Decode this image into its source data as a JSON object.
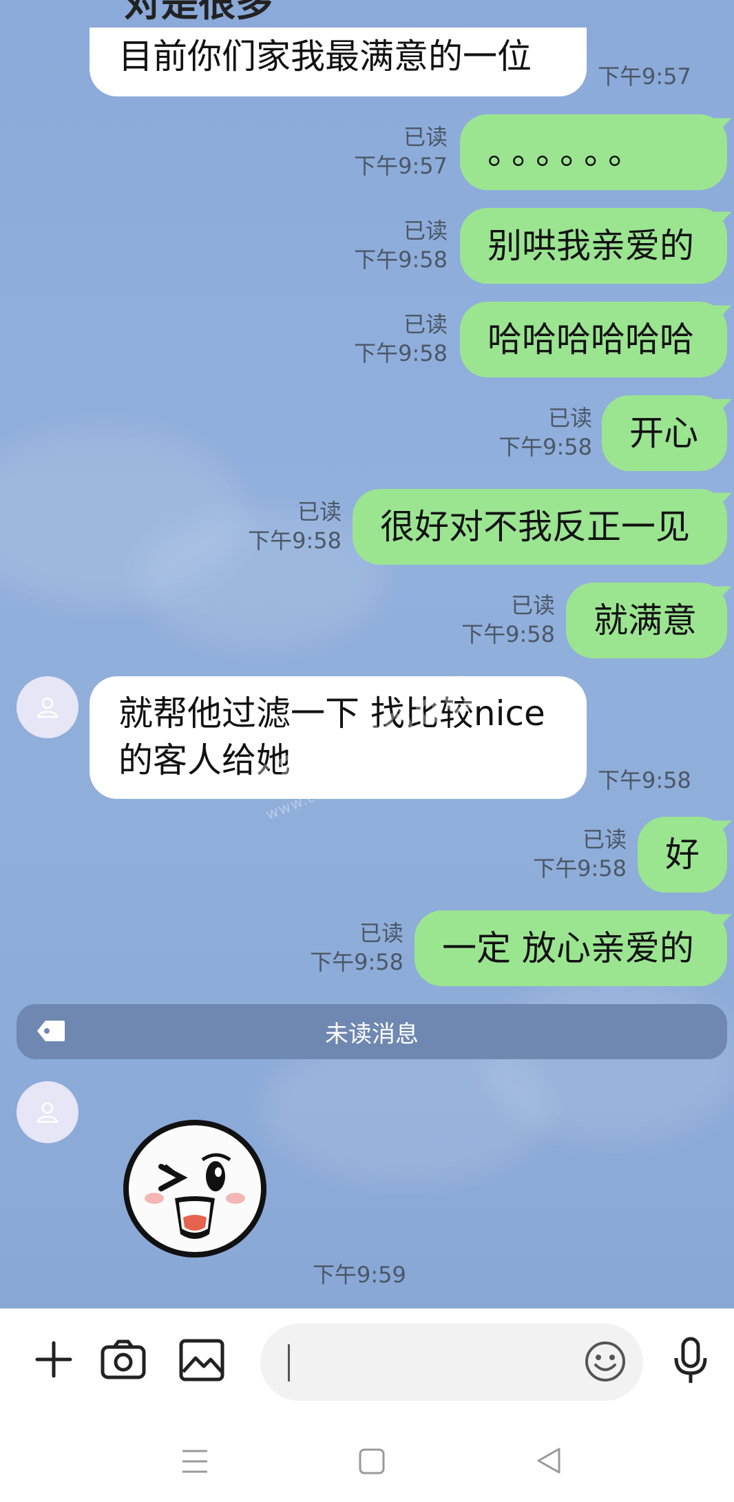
{
  "header": {
    "title_fragment": "对是很多"
  },
  "messages": {
    "m1": {
      "text": "目前你们家我最满意的一位",
      "time": "下午9:57"
    },
    "m2": {
      "text": "。。。。。。",
      "read": "已读",
      "time": "下午9:57"
    },
    "m3": {
      "text": "别哄我亲爱的",
      "read": "已读",
      "time": "下午9:58"
    },
    "m4": {
      "text": "哈哈哈哈哈哈",
      "read": "已读",
      "time": "下午9:58"
    },
    "m5": {
      "text": "开心",
      "read": "已读",
      "time": "下午9:58"
    },
    "m6": {
      "text": "很好对不我反正一见",
      "read": "已读",
      "time": "下午9:58"
    },
    "m7": {
      "text": "就满意",
      "read": "已读",
      "time": "下午9:58"
    },
    "m8": {
      "line1": "就帮他过滤一下 找比较nice",
      "line2": "的客人给她",
      "time": "下午9:58"
    },
    "m9": {
      "text": "好",
      "read": "已读",
      "time": "下午9:58"
    },
    "m10": {
      "text": "一定 放心亲爱的",
      "read": "已读",
      "time": "下午9:58"
    },
    "sticker": {
      "time": "下午9:59"
    }
  },
  "unread_divider": {
    "label": "未读消息"
  },
  "watermark": {
    "brand": "catchgod",
    "url": "www.catchgod.com 开脑网"
  },
  "input": {
    "placeholder": ""
  },
  "colors": {
    "incoming": "#ffffff",
    "outgoing": "#9be591",
    "background": "#8eaedb"
  },
  "icons": [
    "plus-icon",
    "camera-icon",
    "image-icon",
    "emoji-icon",
    "mic-icon",
    "menu-icon",
    "home-icon",
    "back-icon",
    "tag-icon",
    "person-icon"
  ]
}
